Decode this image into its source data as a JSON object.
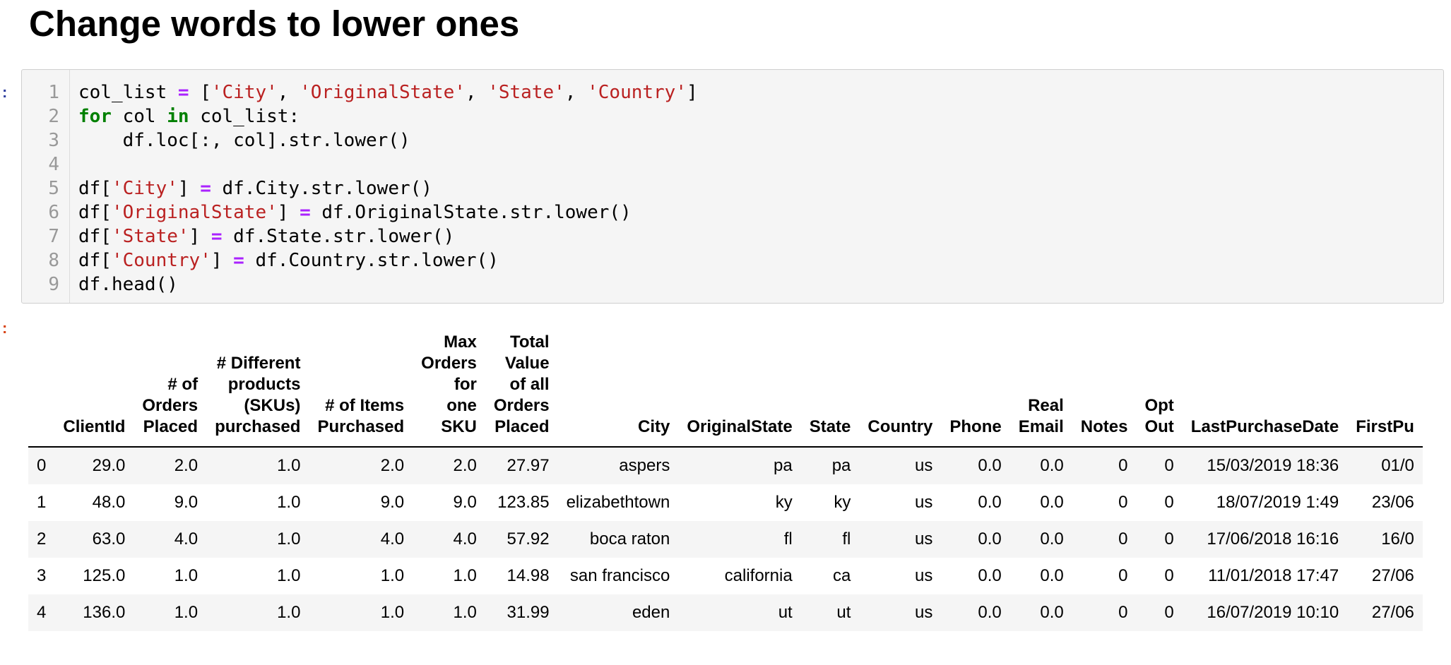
{
  "heading": "Change words to lower ones",
  "prompts": {
    "input": ":",
    "output": ":"
  },
  "code_lines": [
    [
      {
        "t": "col_list ",
        "c": "plain"
      },
      {
        "t": "=",
        "c": "op"
      },
      {
        "t": " [",
        "c": "plain"
      },
      {
        "t": "'City'",
        "c": "str"
      },
      {
        "t": ", ",
        "c": "plain"
      },
      {
        "t": "'OriginalState'",
        "c": "str"
      },
      {
        "t": ", ",
        "c": "plain"
      },
      {
        "t": "'State'",
        "c": "str"
      },
      {
        "t": ", ",
        "c": "plain"
      },
      {
        "t": "'Country'",
        "c": "str"
      },
      {
        "t": "]",
        "c": "plain"
      }
    ],
    [
      {
        "t": "for",
        "c": "kw"
      },
      {
        "t": " col ",
        "c": "plain"
      },
      {
        "t": "in",
        "c": "kw"
      },
      {
        "t": " col_list:",
        "c": "plain"
      }
    ],
    [
      {
        "t": "    df.loc[:, col].str.lower()",
        "c": "plain"
      }
    ],
    [],
    [
      {
        "t": "df[",
        "c": "plain"
      },
      {
        "t": "'City'",
        "c": "str"
      },
      {
        "t": "] ",
        "c": "plain"
      },
      {
        "t": "=",
        "c": "op"
      },
      {
        "t": " df.City.str.lower()",
        "c": "plain"
      }
    ],
    [
      {
        "t": "df[",
        "c": "plain"
      },
      {
        "t": "'OriginalState'",
        "c": "str"
      },
      {
        "t": "] ",
        "c": "plain"
      },
      {
        "t": "=",
        "c": "op"
      },
      {
        "t": " df.OriginalState.str.lower()",
        "c": "plain"
      }
    ],
    [
      {
        "t": "df[",
        "c": "plain"
      },
      {
        "t": "'State'",
        "c": "str"
      },
      {
        "t": "] ",
        "c": "plain"
      },
      {
        "t": "=",
        "c": "op"
      },
      {
        "t": " df.State.str.lower()",
        "c": "plain"
      }
    ],
    [
      {
        "t": "df[",
        "c": "plain"
      },
      {
        "t": "'Country'",
        "c": "str"
      },
      {
        "t": "] ",
        "c": "plain"
      },
      {
        "t": "=",
        "c": "op"
      },
      {
        "t": " df.Country.str.lower()",
        "c": "plain"
      }
    ],
    [
      {
        "t": "df.head()",
        "c": "plain"
      }
    ]
  ],
  "line_numbers": [
    "1",
    "2",
    "3",
    "4",
    "5",
    "6",
    "7",
    "8",
    "9"
  ],
  "table": {
    "columns": [
      [],
      [
        "ClientId"
      ],
      [
        "# of",
        "Orders",
        "Placed"
      ],
      [
        "# Different",
        "products",
        "(SKUs)",
        "purchased"
      ],
      [
        "# of Items",
        "Purchased"
      ],
      [
        "Max",
        "Orders",
        "for",
        "one",
        "SKU"
      ],
      [
        "Total",
        "Value",
        "of all",
        "Orders",
        "Placed"
      ],
      [
        "City"
      ],
      [
        "OriginalState"
      ],
      [
        "State"
      ],
      [
        "Country"
      ],
      [
        "Phone"
      ],
      [
        "Real",
        "Email"
      ],
      [
        "Notes"
      ],
      [
        "Opt",
        "Out"
      ],
      [
        "LastPurchaseDate"
      ],
      [
        "FirstPu"
      ]
    ],
    "rows": [
      [
        "0",
        "29.0",
        "2.0",
        "1.0",
        "2.0",
        "2.0",
        "27.97",
        "aspers",
        "pa",
        "pa",
        "us",
        "0.0",
        "0.0",
        "0",
        "0",
        "15/03/2019 18:36",
        "01/0"
      ],
      [
        "1",
        "48.0",
        "9.0",
        "1.0",
        "9.0",
        "9.0",
        "123.85",
        "elizabethtown",
        "ky",
        "ky",
        "us",
        "0.0",
        "0.0",
        "0",
        "0",
        "18/07/2019 1:49",
        "23/06"
      ],
      [
        "2",
        "63.0",
        "4.0",
        "1.0",
        "4.0",
        "4.0",
        "57.92",
        "boca raton",
        "fl",
        "fl",
        "us",
        "0.0",
        "0.0",
        "0",
        "0",
        "17/06/2018 16:16",
        "16/0"
      ],
      [
        "3",
        "125.0",
        "1.0",
        "1.0",
        "1.0",
        "1.0",
        "14.98",
        "san francisco",
        "california",
        "ca",
        "us",
        "0.0",
        "0.0",
        "0",
        "0",
        "11/01/2018 17:47",
        "27/06"
      ],
      [
        "4",
        "136.0",
        "1.0",
        "1.0",
        "1.0",
        "1.0",
        "31.99",
        "eden",
        "ut",
        "ut",
        "us",
        "0.0",
        "0.0",
        "0",
        "0",
        "16/07/2019 10:10",
        "27/06"
      ]
    ]
  },
  "colors": {
    "string": "#ba2121",
    "operator": "#aa22ff",
    "keyword": "#008000",
    "input_prompt": "#303f9f",
    "output_prompt": "#d84315"
  }
}
